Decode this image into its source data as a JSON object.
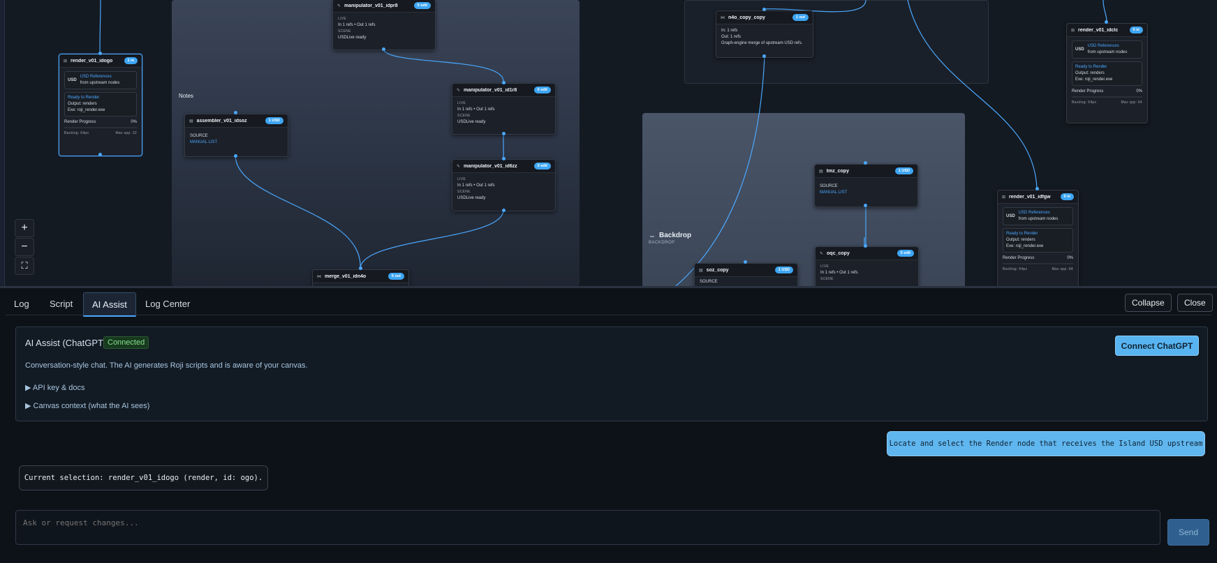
{
  "canvas": {
    "group_notes_label": "Notes",
    "backdrop": {
      "title": "Backdrop",
      "subtitle": "BACKDROP"
    },
    "zoom": {
      "in": "+",
      "out": "−",
      "fit": "⛶"
    },
    "nodes": {
      "render_ogo": {
        "title": "render_v01_idogo",
        "badge": "1 in",
        "usd_tag": "USD",
        "usd_refs": "USD References",
        "usd_from": "from upstream nodes",
        "status": "Ready to Render",
        "output": "Output: renders",
        "exe": "Exe: roji_render.exe",
        "progress_label": "Render Progress",
        "progress_value": "0%",
        "backlog": "Backlog: 64px",
        "max": "Max spp: 32"
      },
      "manip_dpr8": {
        "title": "manipulator_v01_idpr8",
        "badge": "0 edit",
        "live_label": "LIVE",
        "refs": "In 1 refs  •  Out 1 refs",
        "scene_label": "SCENE",
        "scene": "USDLive ready"
      },
      "manip_d1r8": {
        "title": "manipulator_v01_id1r8",
        "badge": "0 edit",
        "live_label": "LIVE",
        "refs": "In 1 refs  •  Out 1 refs",
        "scene_label": "SCENE",
        "scene": "USDLive ready"
      },
      "manip_d6zz": {
        "title": "manipulator_v01_id6zz",
        "badge": "0 edit",
        "live_label": "LIVE",
        "refs": "In 1 refs  •  Out 1 refs",
        "scene_label": "SCENE",
        "scene": "USDLive ready"
      },
      "assembler": {
        "title": "assembler_v01_idsoz",
        "badge": "1 USD",
        "source_label": "SOURCE",
        "source": "MANUAL LIST"
      },
      "merge": {
        "title": "merge_v01_idn4o",
        "badge": "5 out"
      },
      "n4o_copy": {
        "title": "n4o_copy_copy",
        "badge": "1 out",
        "in": "In: 1 refs",
        "out": "Out: 1 refs",
        "desc": "Graph-engine merge of upstream USD refs."
      },
      "tmz_copy": {
        "title": "tmz_copy",
        "badge": "1 USD",
        "source_label": "SOURCE",
        "source": "MANUAL LIST"
      },
      "oqc_copy": {
        "title": "oqc_copy",
        "badge": "0 edit",
        "live_label": "LIVE",
        "refs": "In 1 refs  •  Out 1 refs",
        "scene_label": "SCENE"
      },
      "soz_copy": {
        "title": "soz_copy",
        "badge": "1 USD",
        "source_label": "SOURCE"
      },
      "render_dclc": {
        "title": "render_v01_idclc",
        "badge": "0 in",
        "usd_tag": "USD",
        "usd_refs": "USD References",
        "usd_from": "from upstream nodes",
        "status": "Ready to Render",
        "output": "Output: renders",
        "exe": "Exe: roji_render.exe",
        "progress_label": "Render Progress",
        "progress_value": "0%",
        "backlog": "Backlog: 64px",
        "max": "Max spp: 64"
      },
      "render_dfgw": {
        "title": "render_v01_idfgw",
        "badge": "0 in",
        "usd_tag": "USD",
        "usd_refs": "USD References",
        "usd_from": "from upstream nodes",
        "status": "Ready to Render",
        "output": "Output: renders",
        "exe": "Exe: roji_render.exe",
        "progress_label": "Render Progress",
        "progress_value": "0%",
        "backlog": "Backlog: 64px",
        "max": "Max spp: 64"
      }
    }
  },
  "panel": {
    "tabs": [
      "Log",
      "Script",
      "AI Assist",
      "Log Center"
    ],
    "collapse": "Collapse",
    "close": "Close",
    "ai": {
      "title": "AI Assist (ChatGPT)",
      "status": "Connected",
      "connect_button": "Connect ChatGPT",
      "description": "Conversation-style chat. The AI generates Roji scripts and is aware of your canvas.",
      "details_api": "▶ API key & docs",
      "details_context": "▶ Canvas context (what the AI sees)"
    },
    "chat": {
      "user_message": "Locate and select the Render node that receives the Island USD upstream",
      "assistant_message": "Current selection: render_v01_idogo (render, id: ogo)."
    },
    "input": {
      "placeholder": "Ask or request changes...",
      "value": ""
    },
    "send": "Send"
  },
  "colors": {
    "accent": "#4aa8ff",
    "badge": "#3ea6f4",
    "connected": "#86e08a"
  }
}
